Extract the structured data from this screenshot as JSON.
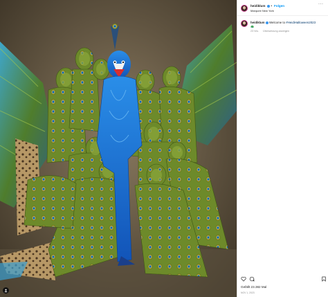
{
  "post": {
    "username": "heidiklum",
    "follow_label": "Folgen",
    "separator": "•",
    "location": "Marquee New York",
    "caption_user": "heidiklum",
    "caption_text": "Welcome to ",
    "caption_hashtag": "#HeidiHalloween2023",
    "caption_emoji": "🦚",
    "caption_time": "23 Wo.",
    "see_translation": "Übersetzung anzeigen",
    "likes_text": "Gefällt 23.382 Mal",
    "date_text": "NOV 1, 2023"
  },
  "icons": {
    "more": "more-options-icon",
    "like": "heart-icon",
    "comment": "comment-icon",
    "bookmark": "bookmark-icon",
    "tagged": "user-tag-icon"
  },
  "colors": {
    "accent": "#0095f6",
    "verified": "#3897f0",
    "peacock_blue": "#1a6fd6",
    "feather_green": "#6d8a2a"
  }
}
